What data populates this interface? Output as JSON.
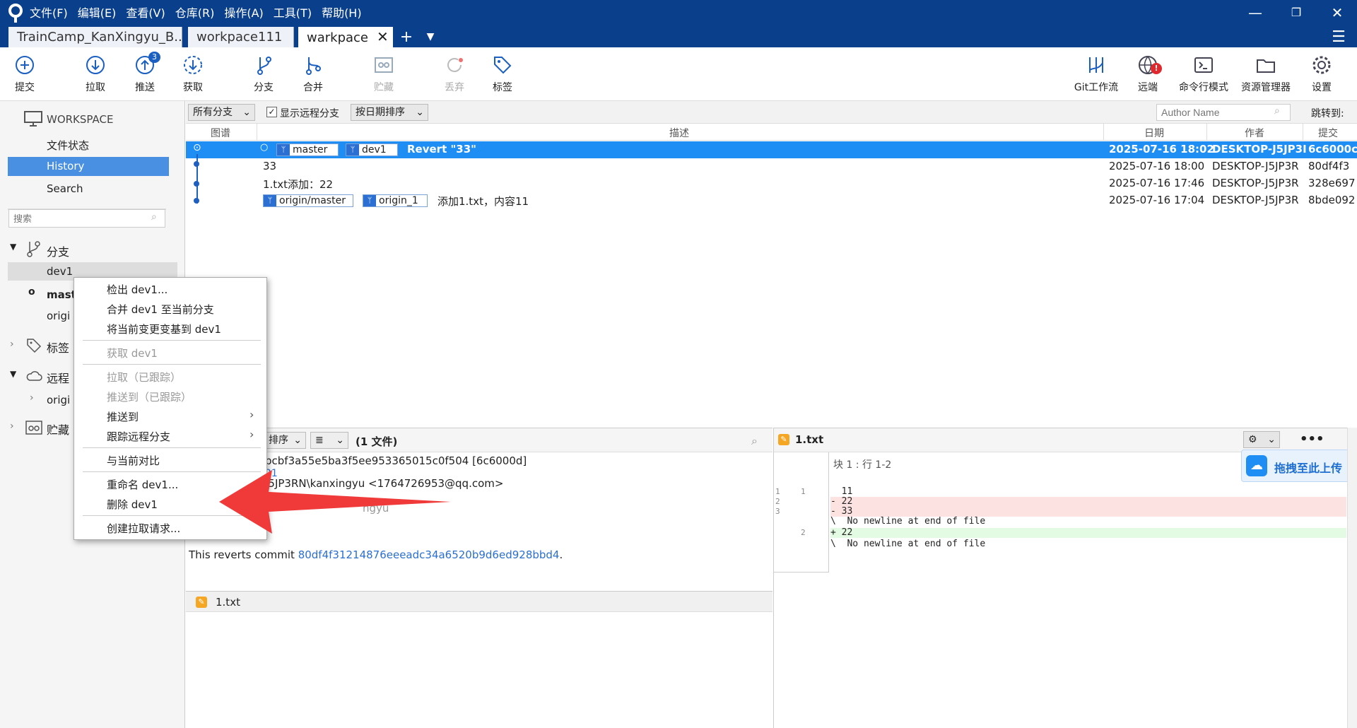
{
  "menu": [
    "文件(F)",
    "编辑(E)",
    "查看(V)",
    "仓库(R)",
    "操作(A)",
    "工具(T)",
    "帮助(H)"
  ],
  "tabs": [
    {
      "label": "TrainCamp_KanXingyu_B..."
    },
    {
      "label": "workpace111"
    },
    {
      "label": "warkpace"
    }
  ],
  "toolbar": {
    "commit": "提交",
    "pull": "拉取",
    "push": "推送",
    "push_badge": "3",
    "fetch": "获取",
    "branch": "分支",
    "merge": "合并",
    "stash": "贮藏",
    "discard": "丢弃",
    "tag": "标签",
    "gitflow": "Git工作流",
    "remote": "远端",
    "terminal": "命令行模式",
    "explorer": "资源管理器",
    "settings": "设置",
    "remote_badge": "!"
  },
  "sidebar": {
    "workspace": "WORKSPACE",
    "file_status": "文件状态",
    "history": "History",
    "search": "Search",
    "search_placeholder": "搜索",
    "branches_title": "分支",
    "branch_items": [
      "dev1",
      "mast",
      "origi"
    ],
    "tags_title": "标签",
    "remotes_title": "远程",
    "remote_item": "origi",
    "stash_title": "贮藏"
  },
  "filter": {
    "branches": "所有分支",
    "show_remote": "显示远程分支",
    "sort": "按日期排序",
    "author_placeholder": "Author Name",
    "jump_to": "跳转到:"
  },
  "columns": {
    "graph": "图谱",
    "desc": "描述",
    "date": "日期",
    "author": "作者",
    "commit": "提交"
  },
  "commits": [
    {
      "tags": [
        "master",
        "dev1"
      ],
      "desc": "Revert \"33\"",
      "date": "2025-07-16 18:02",
      "author": "DESKTOP-J5JP3I",
      "hash": "6c6000c"
    },
    {
      "tags": [],
      "desc": "33",
      "date": "2025-07-16 18:00",
      "author": "DESKTOP-J5JP3R",
      "hash": "80df4f3"
    },
    {
      "tags": [],
      "desc": "1.txt添加：22",
      "date": "2025-07-16 17:46",
      "author": "DESKTOP-J5JP3R",
      "hash": "328e697"
    },
    {
      "tags": [
        "origin/master",
        "origin_1"
      ],
      "desc": "添加1.txt，内容11",
      "date": "2025-07-16 17:04",
      "author": "DESKTOP-J5JP3R",
      "hash": "8bde092"
    }
  ],
  "lower": {
    "sort": "排序",
    "file_count": "(1 文件)",
    "detail_hash": "bcbf3a55e5ba3f5ee953365015c0f504 [6c6000d]",
    "detail_parent": "21",
    "detail_author": "J5JP3RN\\kanxingyu <1764726953@qq.com>",
    "detail_committer": "ngyu",
    "revert_prefix": "This reverts commit ",
    "revert_hash": "80df4f31214876eeeadc34a6520b9d6ed928bbd4",
    "revert_suffix": ".",
    "file_name": "1.txt"
  },
  "diff": {
    "file": "1.txt",
    "hunk": "块 1 :  行 1-2",
    "upload": "拖拽至此上传",
    "lines": [
      {
        "old": "1",
        "new": "1",
        "text": "  11",
        "type": "ctx"
      },
      {
        "old": "2",
        "new": "",
        "text": "- 22",
        "type": "del"
      },
      {
        "old": "3",
        "new": "",
        "text": "- 33",
        "type": "del"
      },
      {
        "old": "",
        "new": "",
        "text": "\\  No newline at end of file",
        "type": "ctx"
      },
      {
        "old": "",
        "new": "2",
        "text": "+ 22",
        "type": "add"
      },
      {
        "old": "",
        "new": "",
        "text": "\\  No newline at end of file",
        "type": "ctx"
      }
    ]
  },
  "context_menu": {
    "checkout": "检出 dev1...",
    "merge": "合并 dev1 至当前分支",
    "rebase": "将当前变更变基到 dev1",
    "fetch": "获取 dev1",
    "pull": "拉取（已跟踪）",
    "push_tracked": "推送到（已跟踪）",
    "push_to": "推送到",
    "track": "跟踪远程分支",
    "diff": "与当前对比",
    "rename": "重命名 dev1...",
    "delete": "删除 dev1",
    "pr": "创建拉取请求..."
  },
  "colors": {
    "titlebar": "#0a3f8c",
    "selection": "#1e8ef5",
    "sidebar_sel": "#4a90e2",
    "arrow": "#f03a3a"
  }
}
